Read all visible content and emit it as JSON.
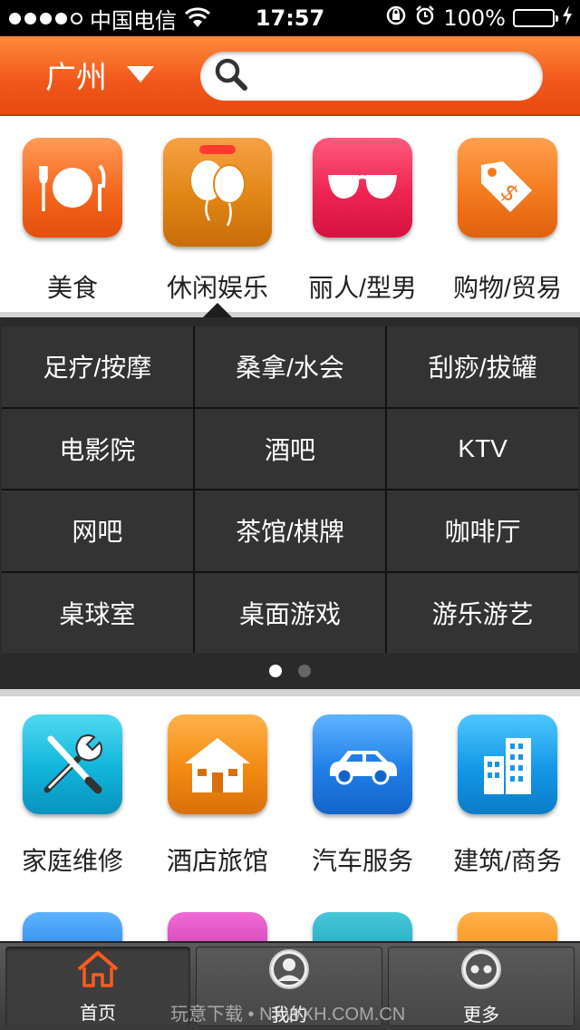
{
  "status_bar": {
    "carrier": "中国电信",
    "time": "17:57",
    "battery": "100%"
  },
  "header": {
    "city": "广州",
    "search_placeholder": ""
  },
  "categories_top": [
    {
      "label": "美食",
      "icon": "dining-icon"
    },
    {
      "label": "休闲娱乐",
      "icon": "balloons-icon"
    },
    {
      "label": "丽人/型男",
      "icon": "sunglasses-icon"
    },
    {
      "label": "购物/贸易",
      "icon": "price-tag-icon"
    }
  ],
  "submenu": {
    "items": [
      "足疗/按摩",
      "桑拿/水会",
      "刮痧/拔罐",
      "电影院",
      "酒吧",
      "KTV",
      "网吧",
      "茶馆/棋牌",
      "咖啡厅",
      "桌球室",
      "桌面游戏",
      "游乐游艺"
    ],
    "page_count": 2,
    "current_page": 1
  },
  "categories_bottom": [
    {
      "label": "家庭维修",
      "icon": "tools-icon"
    },
    {
      "label": "酒店旅馆",
      "icon": "house-icon"
    },
    {
      "label": "汽车服务",
      "icon": "car-icon"
    },
    {
      "label": "建筑/商务",
      "icon": "buildings-icon"
    }
  ],
  "tabbar": {
    "items": [
      {
        "label": "首页",
        "icon": "home-icon"
      },
      {
        "label": "我的",
        "icon": "user-icon"
      },
      {
        "label": "更多",
        "icon": "more-icon"
      }
    ]
  },
  "watermark": "玩意下载 • NXWXH.COM.CN",
  "colors": {
    "header": "#f0561a",
    "home_tab_icon": "#ff5a1f",
    "battery": "#4cd964"
  }
}
